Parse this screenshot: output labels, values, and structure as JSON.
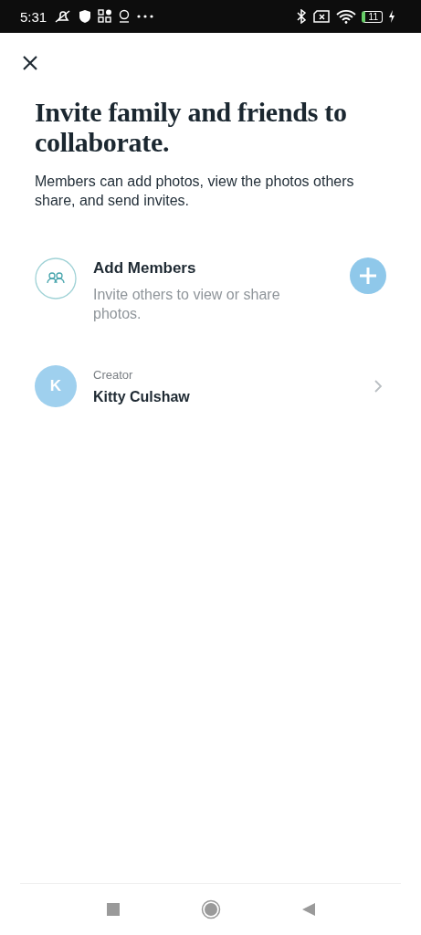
{
  "status_bar": {
    "time": "5:31",
    "battery": "11"
  },
  "title": "Invite family and friends to collaborate.",
  "description": "Members can add photos, view the photos others share, and send invites.",
  "add_members": {
    "title": "Add Members",
    "subtitle": "Invite others to view or share photos."
  },
  "members": [
    {
      "initial": "K",
      "role": "Creator",
      "name": "Kitty Culshaw"
    }
  ]
}
